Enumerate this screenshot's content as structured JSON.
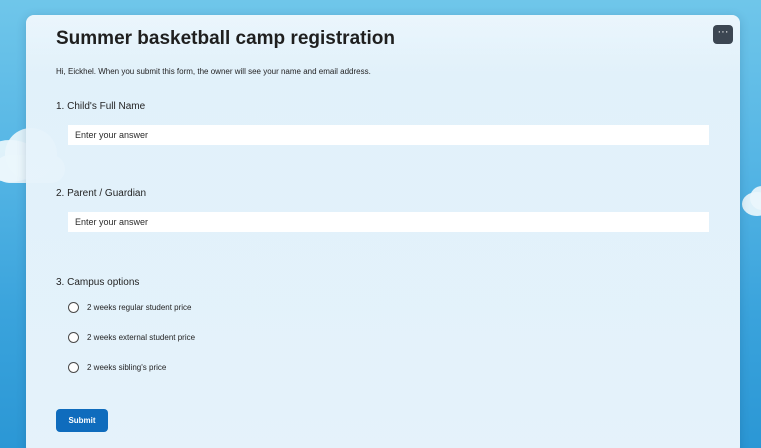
{
  "form": {
    "title": "Summer basketball camp registration",
    "intro": "Hi, Eickhel. When you submit this form, the owner will see your name and email address.",
    "more_button_label": "···",
    "questions": [
      {
        "label": "1. Child's Full Name",
        "placeholder": "Enter your answer",
        "value": ""
      },
      {
        "label": "2. Parent / Guardian",
        "placeholder": "Enter your answer",
        "value": ""
      },
      {
        "label": "3. Campus options",
        "options": [
          {
            "label": "2 weeks regular student price",
            "selected": false
          },
          {
            "label": "2 weeks external student price",
            "selected": false
          },
          {
            "label": "2 weeks sibling's price",
            "selected": false
          }
        ]
      }
    ],
    "submit_label": "Submit"
  },
  "colors": {
    "accent": "#0f6cbd",
    "background_sky": "#4aafe2",
    "card": "#e6f3fb",
    "more_button": "#3c4652"
  },
  "icons": {
    "more": "more-options-icon",
    "radio": "radio-button-icon"
  }
}
